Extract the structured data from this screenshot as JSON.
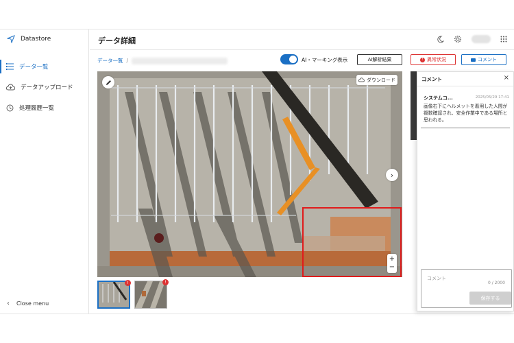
{
  "sidebar": {
    "brand": "Datastore",
    "items": [
      {
        "label": "データ一覧",
        "icon": "list-icon",
        "active": true
      },
      {
        "label": "データアップロード",
        "icon": "cloud-upload-icon",
        "active": false
      },
      {
        "label": "処理履歴一覧",
        "icon": "history-icon",
        "active": false
      }
    ],
    "close_label": "Close menu"
  },
  "header": {
    "title": "データ詳細"
  },
  "breadcrumb": {
    "root": "データ一覧",
    "separator": "/"
  },
  "toolbar": {
    "toggle_label": "AI・マーキング表示",
    "ai_button": "AI解析結果",
    "alert_button": "異常状況",
    "comment_button": "コメント"
  },
  "viewer": {
    "download_label": "ダウンロード",
    "zoom_in": "+",
    "zoom_out": "−",
    "next": "›"
  },
  "thumbnails": [
    {
      "selected": true,
      "badge": "!"
    },
    {
      "selected": false,
      "badge": "!"
    }
  ],
  "comments_panel": {
    "title": "コメント",
    "close": "×",
    "comments": [
      {
        "author": "システムコ...",
        "time": "2025/05/29 17:41",
        "body": "画像右下にヘルメットを着用した人間が複数確認され、安全作業中である場所と思われる。"
      }
    ],
    "placeholder": "コメント",
    "counter": "0 / 2000",
    "save_label": "保存する"
  },
  "colors": {
    "accent": "#1a6fc4",
    "alert": "#dd3333",
    "detection_box": "#e01b1b"
  }
}
